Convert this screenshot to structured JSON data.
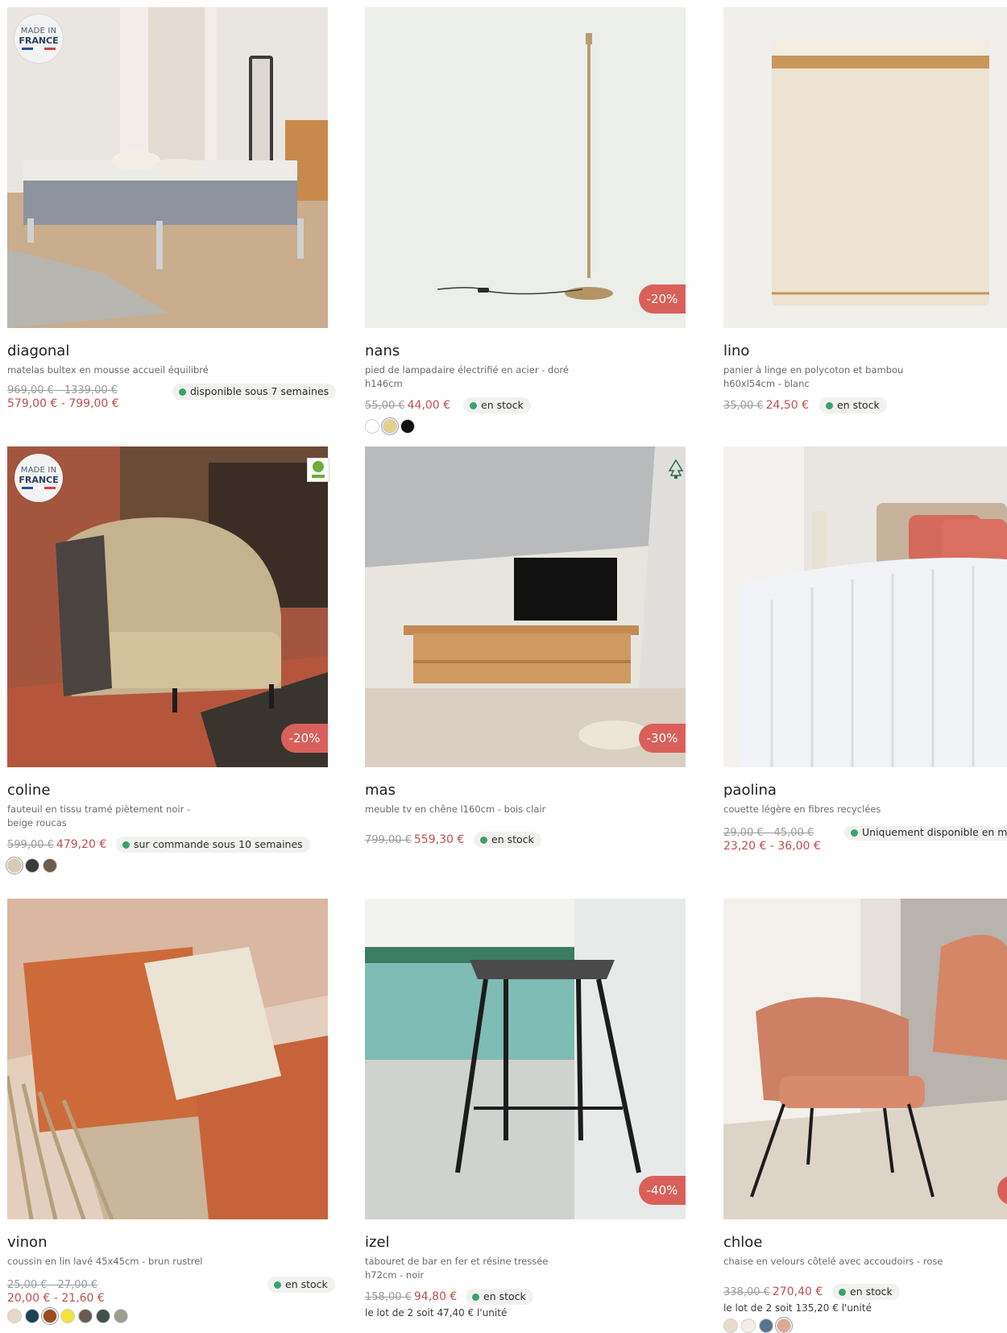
{
  "badges": {
    "made_in_1": "MADE IN",
    "made_in_2": "FRANCE"
  },
  "colors": {
    "discount": "#d9605a",
    "price_new": "#c0504b",
    "in_stock_dot": "#3aa26a"
  },
  "products": [
    {
      "name": "diagonal",
      "desc": "matelas bultex en mousse accueil équilibré",
      "old_price": "969,00 € - 1339,00 €",
      "new_price": "579,00 € - 799,00 €",
      "stock": "disponible sous 7 semaines",
      "made_in_france": true
    },
    {
      "name": "nans",
      "desc": "pied de lampadaire électrifié en acier - doré h146cm",
      "old_price": "55,00 €",
      "new_price": "44,00 €",
      "stock": "en stock",
      "discount": "-20%",
      "swatches": [
        "#ffffff",
        "#e6cf8c",
        "#111111"
      ]
    },
    {
      "name": "lino",
      "desc": "panier à linge en polycoton et bambou h60xl54cm - blanc",
      "old_price": "35,00 €",
      "new_price": "24,50 €",
      "stock": "en stock"
    },
    {
      "name": "coline",
      "desc": "fauteuil en tissu tramé piètement noir - beige roucas",
      "old_price": "599,00 €",
      "new_price": "479,20 €",
      "stock": "sur commande sous 10 semaines",
      "discount": "-20%",
      "made_in_france": true,
      "certification": "PEFC",
      "swatches": [
        "#d9cbb2",
        "#3b3b3b",
        "#6e5d4c"
      ]
    },
    {
      "name": "mas",
      "desc": "meuble tv en chêne l160cm - bois clair",
      "old_price": "799,00 €",
      "new_price": "559,30 €",
      "stock": "en stock",
      "discount": "-30%",
      "certification": "FSC"
    },
    {
      "name": "paolina",
      "desc": "couette légère en fibres recyclées",
      "old_price": "29,00 € - 45,00 €",
      "new_price": "23,20 € - 36,00 €",
      "stock": "Uniquement disponible en ma"
    },
    {
      "name": "vinon",
      "desc": "coussin en lin lavé 45x45cm - brun rustrel",
      "old_price": "25,00 € - 27,00 €",
      "new_price": "20,00 € - 21,60 €",
      "stock": "en stock",
      "swatches": [
        "#e8d9c6",
        "#1f4157",
        "#9c4a1f",
        "#f2e33b",
        "#6b5b4f",
        "#3f5149",
        "#9aa08c"
      ]
    },
    {
      "name": "izel",
      "desc": "tabouret de bar en fer et résine tressée h72cm - noir",
      "old_price": "158,00 €",
      "new_price": "94,80 €",
      "stock": "en stock",
      "discount": "-40%",
      "lot": "le lot de 2 soit 47,40 € l'unité"
    },
    {
      "name": "chloe",
      "desc": "chaise en velours côtelé avec accoudoirs - rose",
      "old_price": "338,00 €",
      "new_price": "270,40 €",
      "stock": "en stock",
      "lot": "le lot de 2 soit 135,20 € l'unité",
      "swatches": [
        "#e9dccd",
        "#f4efe6",
        "#5a7390",
        "#e0a896"
      ]
    }
  ]
}
